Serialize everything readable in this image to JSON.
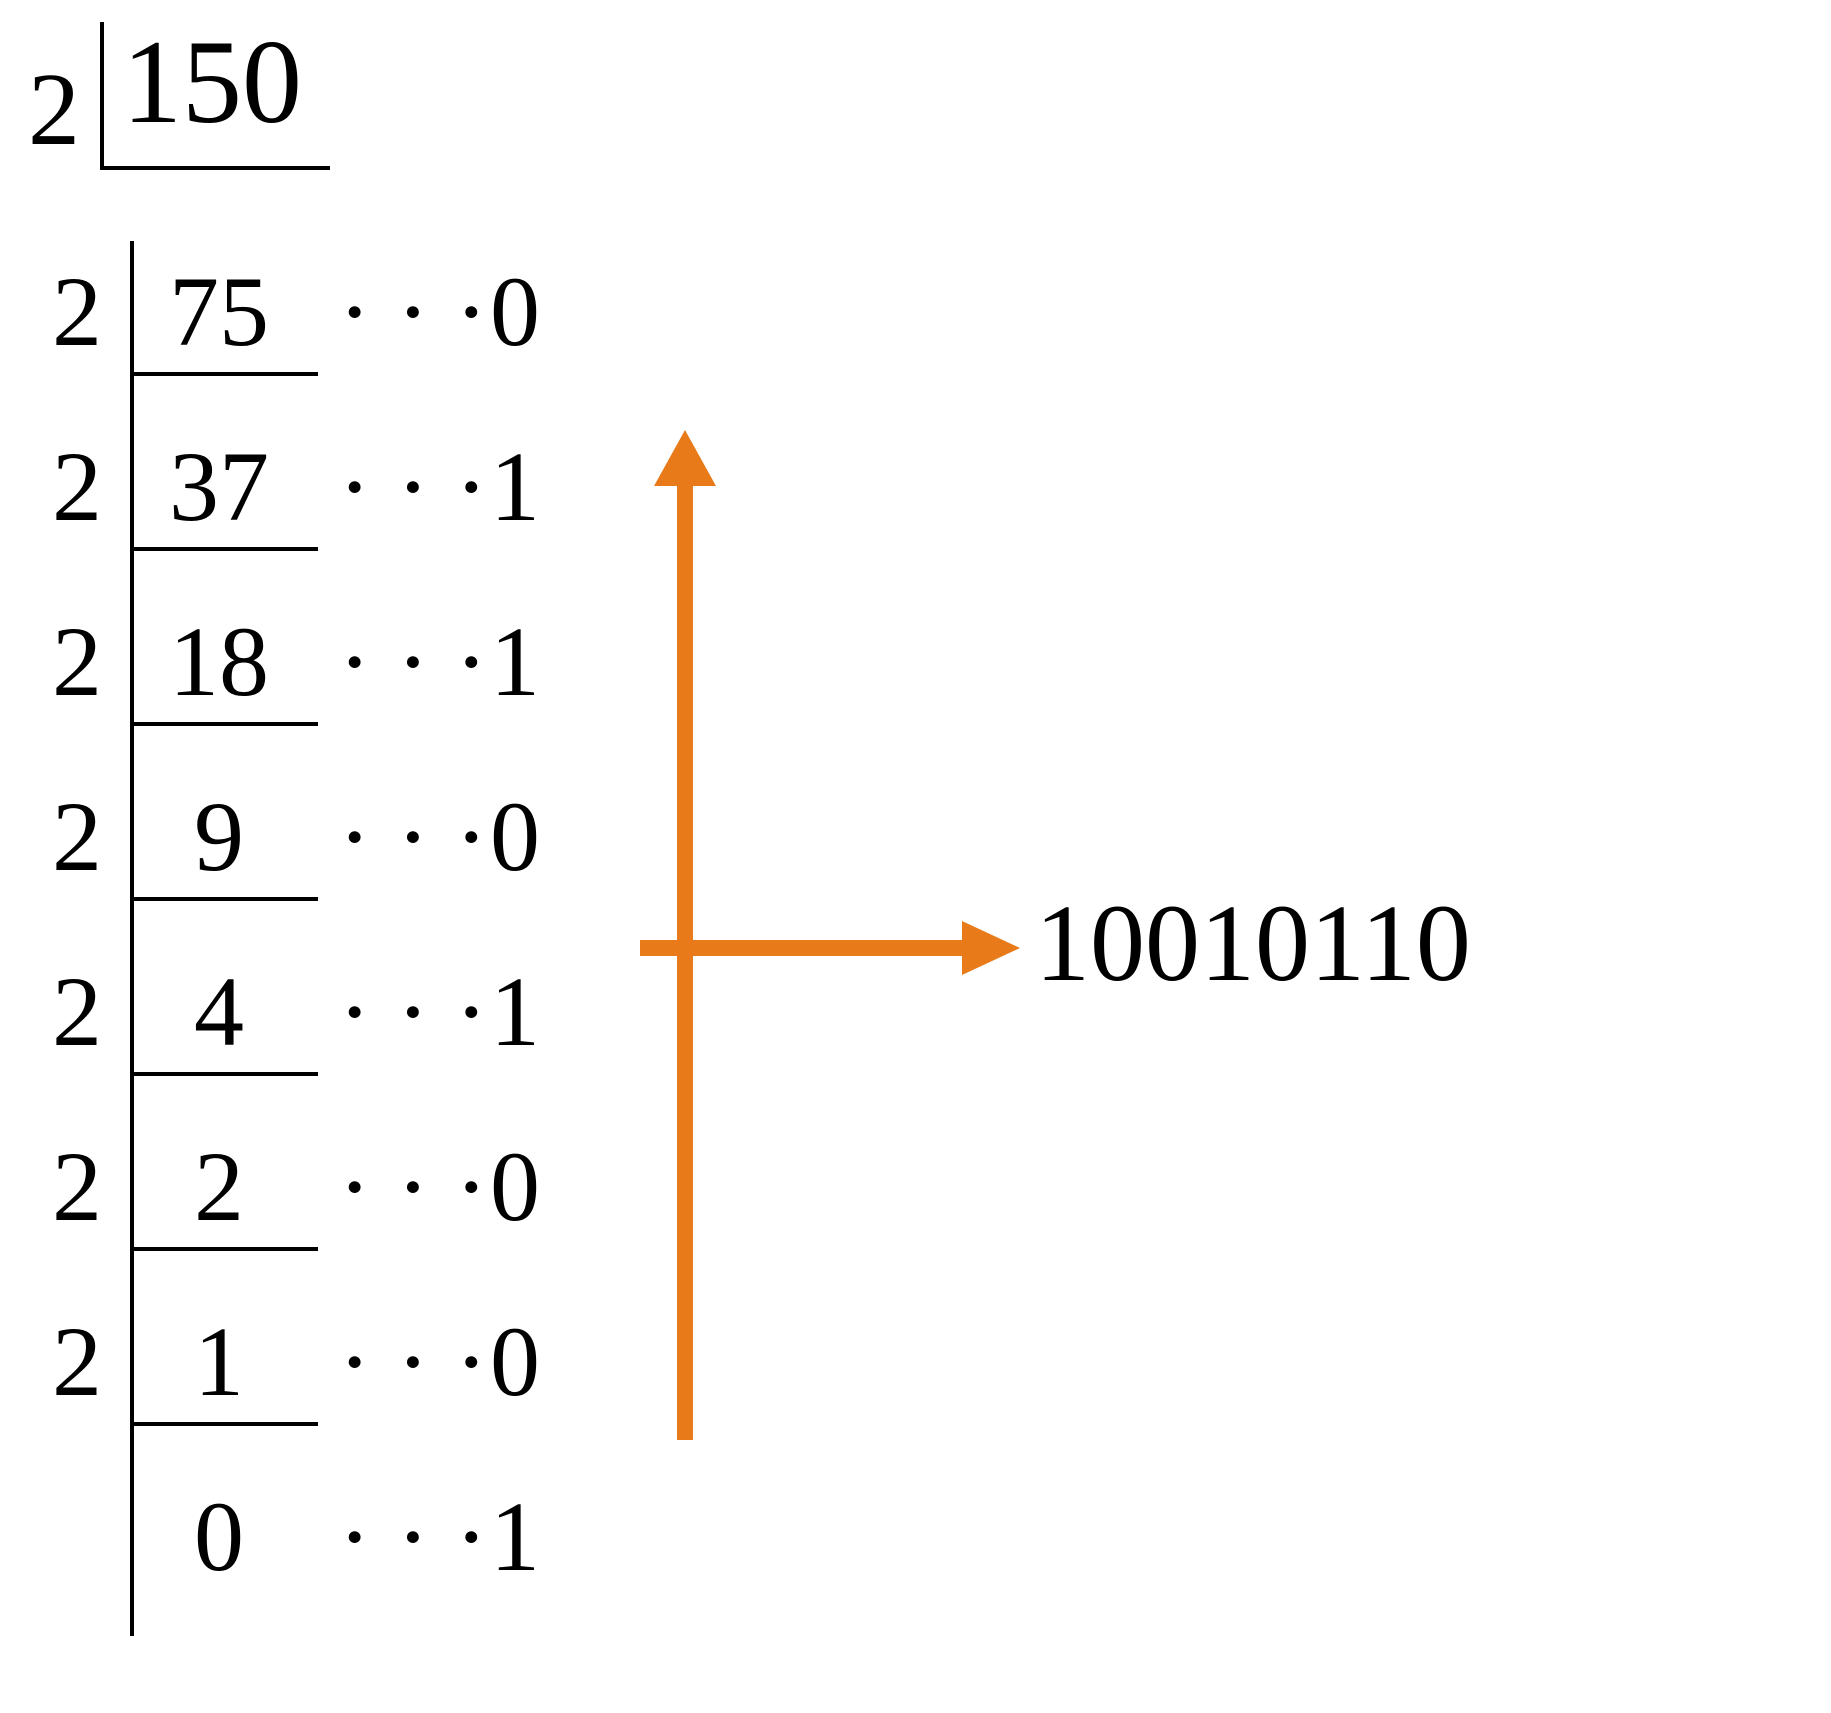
{
  "diagram": {
    "initial": {
      "divisor": "2",
      "dividend": "150"
    },
    "steps": [
      {
        "divisor": "2",
        "quotient": "75",
        "remainder": "0"
      },
      {
        "divisor": "2",
        "quotient": "37",
        "remainder": "1"
      },
      {
        "divisor": "2",
        "quotient": "18",
        "remainder": "1"
      },
      {
        "divisor": "2",
        "quotient": "9",
        "remainder": "0"
      },
      {
        "divisor": "2",
        "quotient": "4",
        "remainder": "1"
      },
      {
        "divisor": "2",
        "quotient": "2",
        "remainder": "0"
      },
      {
        "divisor": "2",
        "quotient": "1",
        "remainder": "0"
      },
      {
        "divisor": "",
        "quotient": "0",
        "remainder": "1"
      }
    ],
    "dots": "· · ·",
    "result": "10010110",
    "arrow_color": "#e87a1a"
  },
  "watermark": ""
}
